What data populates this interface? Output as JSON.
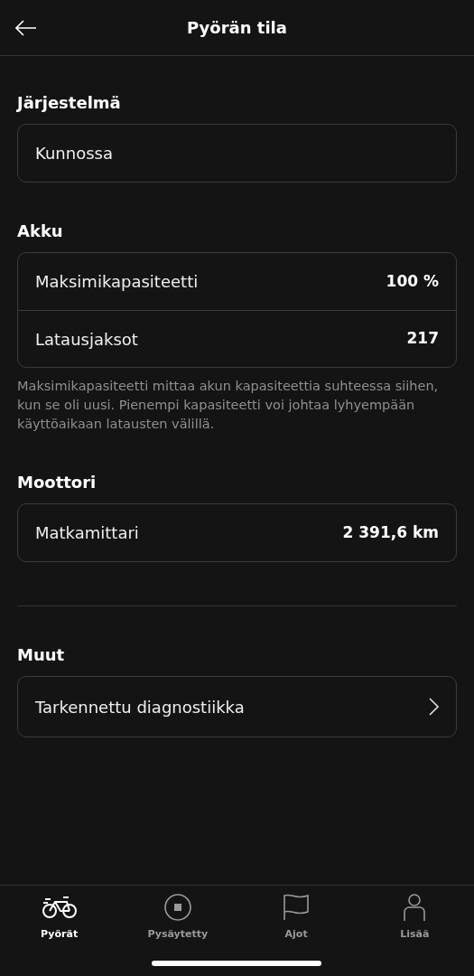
{
  "header": {
    "title": "Pyörän tila"
  },
  "section_groups": [
    [
      {
        "title": "Järjestelmä",
        "rows": [
          {
            "kind": "text",
            "label": "Kunnossa"
          }
        ]
      },
      {
        "title": "Akku",
        "rows": [
          {
            "kind": "value",
            "label": "Maksimikapasiteetti",
            "value": "100 %"
          },
          {
            "kind": "value",
            "label": "Latausjaksot",
            "value": "217"
          }
        ],
        "note": "Maksimikapasiteetti mittaa akun kapasiteettia suhteessa siihen, kun se oli uusi. Pienempi kapasiteetti voi johtaa lyhyempään käyttöaikaan latausten välillä."
      },
      {
        "title": "Moottori",
        "rows": [
          {
            "kind": "value",
            "label": "Matkamittari",
            "value": "2 391,6 km"
          }
        ]
      }
    ],
    [
      {
        "title": "Muut",
        "rows": [
          {
            "kind": "link",
            "label": "Tarkennettu diagnostiikka"
          }
        ]
      }
    ]
  ],
  "tabs": [
    {
      "label": "Pyörät",
      "selected": true
    },
    {
      "label": "Pysäytetty",
      "selected": false
    },
    {
      "label": "Ajot",
      "selected": false
    },
    {
      "label": "Lisää",
      "selected": false
    }
  ]
}
